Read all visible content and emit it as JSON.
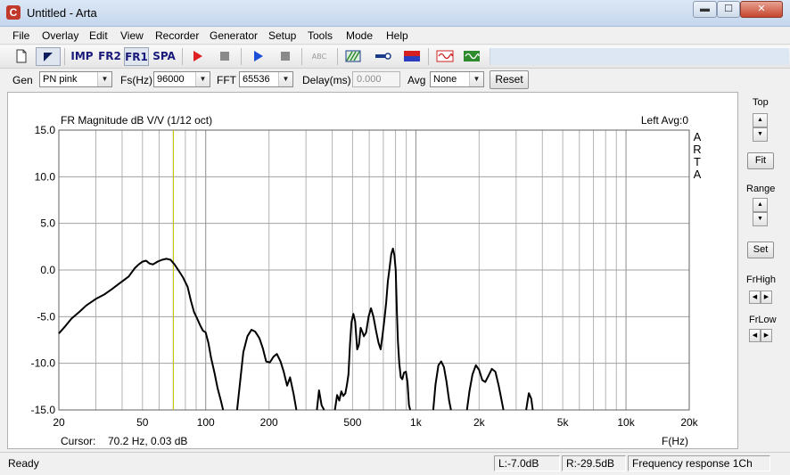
{
  "window": {
    "title": "Untitled - Arta",
    "app_icon": "C",
    "controls": {
      "minimize": "▬",
      "maximize": "☐",
      "close": "✕"
    }
  },
  "menu": [
    "File",
    "Overlay",
    "Edit",
    "View",
    "Recorder",
    "Generator",
    "Setup",
    "Tools",
    "Mode",
    "Help"
  ],
  "toolbar": {
    "imp": "IMP",
    "fr2": "FR2",
    "fr1": "FR1",
    "spa": "SPA",
    "abc": "ABC",
    "colors": {
      "record": "#e02020",
      "play": "#1b4fd6",
      "stop": "#8a8a8a",
      "green": "#2e8b2e",
      "red": "#d42020",
      "blue": "#2a3fbf"
    }
  },
  "settings": {
    "gen_label": "Gen",
    "gen_value": "PN pink",
    "fs_label": "Fs(Hz)",
    "fs_value": "96000",
    "fft_label": "FFT",
    "fft_value": "65536",
    "delay_label": "Delay(ms)",
    "delay_value": "0.000",
    "avg_label": "Avg",
    "avg_value": "None",
    "reset_label": "Reset"
  },
  "side_panel": {
    "top_label": "Top",
    "fit_label": "Fit",
    "range_label": "Range",
    "set_label": "Set",
    "frhigh_label": "FrHigh",
    "frlow_label": "FrLow"
  },
  "status": {
    "ready": "Ready",
    "left_level": "L:-7.0dB",
    "right_level": "R:-29.5dB",
    "mode": "Frequency response 1Ch"
  },
  "chart_data": {
    "type": "line",
    "title": "FR Magnitude dB V/V (1/12 oct)",
    "channel_note": "Left  Avg:0",
    "watermark": [
      "A",
      "R",
      "T",
      "A"
    ],
    "xlabel": "F(Hz)",
    "ylabel": "",
    "xscale": "log",
    "xlim": [
      20,
      20000
    ],
    "ylim": [
      -15,
      15
    ],
    "grid": true,
    "x_tick_labels": [
      {
        "value": 20,
        "label": "20"
      },
      {
        "value": 50,
        "label": "50"
      },
      {
        "value": 100,
        "label": "100"
      },
      {
        "value": 200,
        "label": "200"
      },
      {
        "value": 500,
        "label": "500"
      },
      {
        "value": 1000,
        "label": "1k"
      },
      {
        "value": 2000,
        "label": "2k"
      },
      {
        "value": 5000,
        "label": "5k"
      },
      {
        "value": 10000,
        "label": "10k"
      },
      {
        "value": 20000,
        "label": "20k"
      }
    ],
    "y_ticks": [
      15,
      10,
      5,
      0,
      -5,
      -10,
      -15
    ],
    "y_tick_labels": [
      "15.0",
      "10.0",
      "5.0",
      "0.0",
      "-5.0",
      "-10.0",
      "-15.0"
    ],
    "cursor": {
      "frequency": 70.2,
      "label": "Cursor:",
      "readout": "70.2 Hz, 0.03 dB",
      "color": "#c8c800"
    },
    "curve_color": "#000000",
    "series": [
      {
        "segments": [
          [
            [
              20,
              -6.8
            ],
            [
              21.5,
              -6.0
            ],
            [
              23,
              -5.2
            ],
            [
              25,
              -4.5
            ],
            [
              27,
              -3.8
            ],
            [
              30,
              -3.1
            ],
            [
              33,
              -2.6
            ],
            [
              36,
              -2.0
            ],
            [
              39,
              -1.4
            ],
            [
              43,
              -0.7
            ],
            [
              46,
              0.2
            ],
            [
              48,
              0.6
            ],
            [
              50,
              0.9
            ],
            [
              52,
              1.0
            ],
            [
              54,
              0.7
            ],
            [
              56,
              0.6
            ],
            [
              59,
              0.9
            ],
            [
              62,
              1.1
            ],
            [
              65,
              1.2
            ],
            [
              68,
              1.1
            ],
            [
              71,
              0.6
            ],
            [
              75,
              -0.2
            ],
            [
              78,
              -0.8
            ],
            [
              82,
              -1.8
            ],
            [
              85,
              -3.3
            ],
            [
              88,
              -4.5
            ],
            [
              91,
              -5.2
            ],
            [
              94,
              -5.9
            ],
            [
              97,
              -6.5
            ],
            [
              100,
              -6.7
            ],
            [
              103,
              -7.8
            ],
            [
              106,
              -9.4
            ],
            [
              110,
              -11.0
            ],
            [
              114,
              -12.7
            ],
            [
              118,
              -14.0
            ],
            [
              121,
              -15.0
            ]
          ],
          [
            [
              141,
              -15.0
            ],
            [
              146,
              -11.8
            ],
            [
              151,
              -8.8
            ],
            [
              158,
              -7.1
            ],
            [
              165,
              -6.4
            ],
            [
              172,
              -6.6
            ],
            [
              180,
              -7.3
            ],
            [
              187,
              -8.4
            ],
            [
              194,
              -9.8
            ],
            [
              202,
              -9.9
            ],
            [
              210,
              -9.3
            ],
            [
              218,
              -9.0
            ],
            [
              227,
              -9.8
            ],
            [
              235,
              -10.9
            ],
            [
              244,
              -12.4
            ],
            [
              252,
              -11.5
            ],
            [
              262,
              -13.3
            ],
            [
              270,
              -15.0
            ]
          ],
          [
            [
              338,
              -15.0
            ],
            [
              346,
              -12.9
            ],
            [
              356,
              -14.5
            ],
            [
              366,
              -15.0
            ]
          ],
          [
            [
              412,
              -15.0
            ],
            [
              422,
              -13.4
            ],
            [
              432,
              -14.0
            ],
            [
              442,
              -13.0
            ],
            [
              452,
              -13.5
            ],
            [
              462,
              -13.2
            ],
            [
              470,
              -12.3
            ],
            [
              478,
              -11.2
            ],
            [
              486,
              -8.0
            ],
            [
              494,
              -5.6
            ],
            [
              504,
              -4.7
            ],
            [
              514,
              -5.5
            ],
            [
              526,
              -8.5
            ],
            [
              536,
              -8.0
            ],
            [
              546,
              -6.2
            ],
            [
              556,
              -6.6
            ],
            [
              566,
              -7.1
            ],
            [
              580,
              -6.7
            ],
            [
              596,
              -5.0
            ],
            [
              612,
              -4.1
            ],
            [
              628,
              -5.0
            ],
            [
              646,
              -6.5
            ],
            [
              664,
              -7.8
            ],
            [
              680,
              -8.5
            ],
            [
              694,
              -7.0
            ],
            [
              708,
              -5.4
            ],
            [
              722,
              -3.5
            ],
            [
              736,
              -1.2
            ],
            [
              750,
              0.2
            ],
            [
              764,
              1.7
            ],
            [
              778,
              2.3
            ],
            [
              790,
              1.6
            ],
            [
              802,
              0.0
            ],
            [
              812,
              -4.4
            ],
            [
              822,
              -7.7
            ],
            [
              834,
              -10.0
            ],
            [
              848,
              -11.5
            ],
            [
              862,
              -11.7
            ],
            [
              878,
              -11.0
            ],
            [
              896,
              -10.9
            ],
            [
              912,
              -12.0
            ],
            [
              928,
              -14.5
            ],
            [
              940,
              -15.0
            ]
          ],
          [
            [
              1210,
              -15.0
            ],
            [
              1240,
              -12.3
            ],
            [
              1280,
              -10.2
            ],
            [
              1320,
              -9.8
            ],
            [
              1360,
              -10.4
            ],
            [
              1400,
              -12.0
            ],
            [
              1440,
              -14.0
            ],
            [
              1470,
              -15.0
            ]
          ],
          [
            [
              1750,
              -15.0
            ],
            [
              1800,
              -13.0
            ],
            [
              1860,
              -11.2
            ],
            [
              1930,
              -10.2
            ],
            [
              2000,
              -10.7
            ],
            [
              2070,
              -11.8
            ],
            [
              2140,
              -12.0
            ],
            [
              2220,
              -11.3
            ],
            [
              2300,
              -10.6
            ],
            [
              2390,
              -10.9
            ],
            [
              2480,
              -12.4
            ],
            [
              2560,
              -14.0
            ],
            [
              2610,
              -15.0
            ]
          ],
          [
            [
              3350,
              -15.0
            ],
            [
              3450,
              -13.2
            ],
            [
              3540,
              -13.8
            ],
            [
              3600,
              -15.0
            ]
          ]
        ]
      }
    ]
  }
}
